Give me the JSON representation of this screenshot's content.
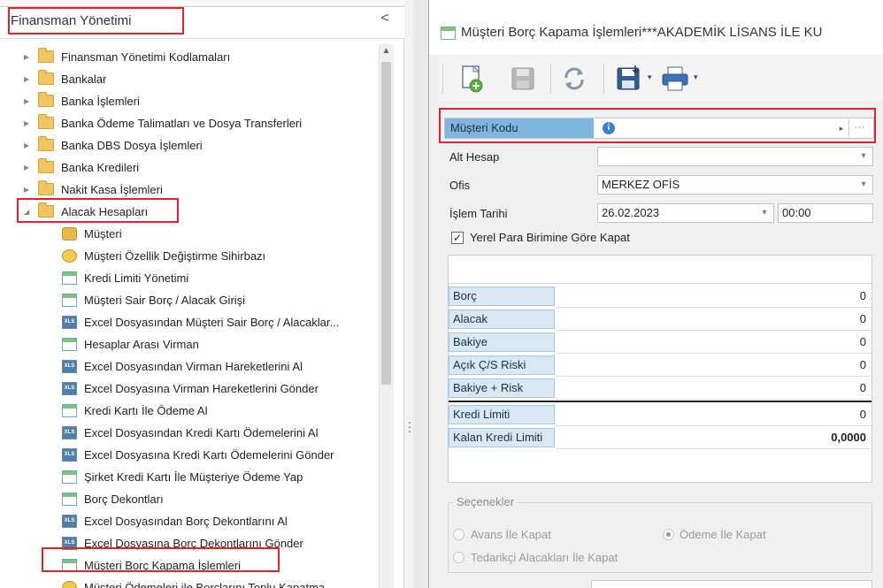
{
  "left_panel": {
    "title": "Finansman Yönetimi",
    "collapse_glyph": "<",
    "tree": [
      {
        "label": "Finansman Yönetimi Kodlamaları",
        "type": "folder",
        "level": 0,
        "expanded": false
      },
      {
        "label": "Bankalar",
        "type": "folder",
        "level": 0,
        "expanded": false
      },
      {
        "label": "Banka İşlemleri",
        "type": "folder",
        "level": 0,
        "expanded": false
      },
      {
        "label": "Banka Ödeme Talimatları ve Dosya Transferleri",
        "type": "folder",
        "level": 0,
        "expanded": false
      },
      {
        "label": "Banka DBS Dosya İşlemleri",
        "type": "folder",
        "level": 0,
        "expanded": false
      },
      {
        "label": "Banka Kredileri",
        "type": "folder",
        "level": 0,
        "expanded": false
      },
      {
        "label": "Nakit Kasa İşlemleri",
        "type": "folder",
        "level": 0,
        "expanded": false
      },
      {
        "label": "Alacak Hesapları",
        "type": "folder",
        "level": 0,
        "expanded": true
      },
      {
        "label": "Müşteri",
        "type": "user",
        "level": 1
      },
      {
        "label": "Müşteri Özellik Değiştirme Sihirbazı",
        "type": "wizard",
        "level": 1
      },
      {
        "label": "Kredi Limiti Yönetimi",
        "type": "window",
        "level": 1
      },
      {
        "label": "Müşteri Sair Borç / Alacak Girişi",
        "type": "window",
        "level": 1
      },
      {
        "label": "Excel Dosyasından Müşteri Sair Borç / Alacaklar...",
        "type": "excel",
        "level": 1
      },
      {
        "label": "Hesaplar Arası Virman",
        "type": "window",
        "level": 1
      },
      {
        "label": "Excel Dosyasından Virman Hareketlerini Al",
        "type": "excel",
        "level": 1
      },
      {
        "label": "Excel Dosyasına Virman Hareketlerini Gönder",
        "type": "excel",
        "level": 1
      },
      {
        "label": "Kredi Kartı İle Ödeme Al",
        "type": "window",
        "level": 1
      },
      {
        "label": "Excel Dosyasından Kredi Kartı Ödemelerini Al",
        "type": "excel",
        "level": 1
      },
      {
        "label": "Excel Dosyasına Kredi Kartı Ödemelerini Gönder",
        "type": "excel",
        "level": 1
      },
      {
        "label": "Şirket Kredi Kartı İle Müşteriye Ödeme Yap",
        "type": "window",
        "level": 1
      },
      {
        "label": "Borç Dekontları",
        "type": "window",
        "level": 1
      },
      {
        "label": "Excel Dosyasından Borç Dekontlarını Al",
        "type": "excel",
        "level": 1
      },
      {
        "label": "Excel Dosyasına Borç Dekontlarını Gönder",
        "type": "excel",
        "level": 1
      },
      {
        "label": "Müşteri Borç Kapama İşlemleri",
        "type": "window",
        "level": 1
      },
      {
        "label": "Müşteri Ödemeleri ile Borçlarını Toplu Kapatma ...",
        "type": "wizard",
        "level": 1
      }
    ]
  },
  "window": {
    "title": "Müşteri Borç Kapama İşlemleri***AKADEMİK LİSANS İLE KU"
  },
  "icons": {
    "new": "new-document-icon",
    "save": "save-icon",
    "refresh": "refresh-icon",
    "export": "export-save-icon",
    "print": "print-icon",
    "dropdown": "▾",
    "info": "i",
    "ellipsis": "···",
    "play": "▸",
    "check": "✓"
  },
  "form": {
    "musteri_kodu_label": "Müşteri Kodu",
    "musteri_kodu_value": "",
    "alt_hesap_label": "Alt Hesap",
    "alt_hesap_value": "",
    "ofis_label": "Ofis",
    "ofis_value": "MERKEZ OFİS",
    "islem_tarihi_label": "İşlem Tarihi",
    "islem_tarihi_value": "26.02.2023",
    "islem_saat_value": "00:00",
    "yerel_para_label": "Yerel Para Birimine Göre Kapat",
    "yerel_para_checked": true
  },
  "summary": [
    {
      "label": "Borç",
      "value": "0"
    },
    {
      "label": "Alacak",
      "value": "0"
    },
    {
      "label": "Bakiye",
      "value": "0"
    },
    {
      "label": "Açık Ç/S Riski",
      "value": "0"
    },
    {
      "label": "Bakiye + Risk",
      "value": "0"
    },
    {
      "label": "Kredi Limiti",
      "value": "0"
    },
    {
      "label": "Kalan Kredi Limiti",
      "value": "0,0000"
    }
  ],
  "options": {
    "title": "Seçenekler",
    "avans": "Avans İle Kapat",
    "odeme": "Ödeme İle Kapat",
    "tedarikci": "Tedarikçi Alacakları İle Kapat",
    "selected": "odeme"
  },
  "colors": {
    "highlight_red": "#e2232a",
    "label_blue": "#7fb6dd",
    "folder": "#f1c560"
  }
}
